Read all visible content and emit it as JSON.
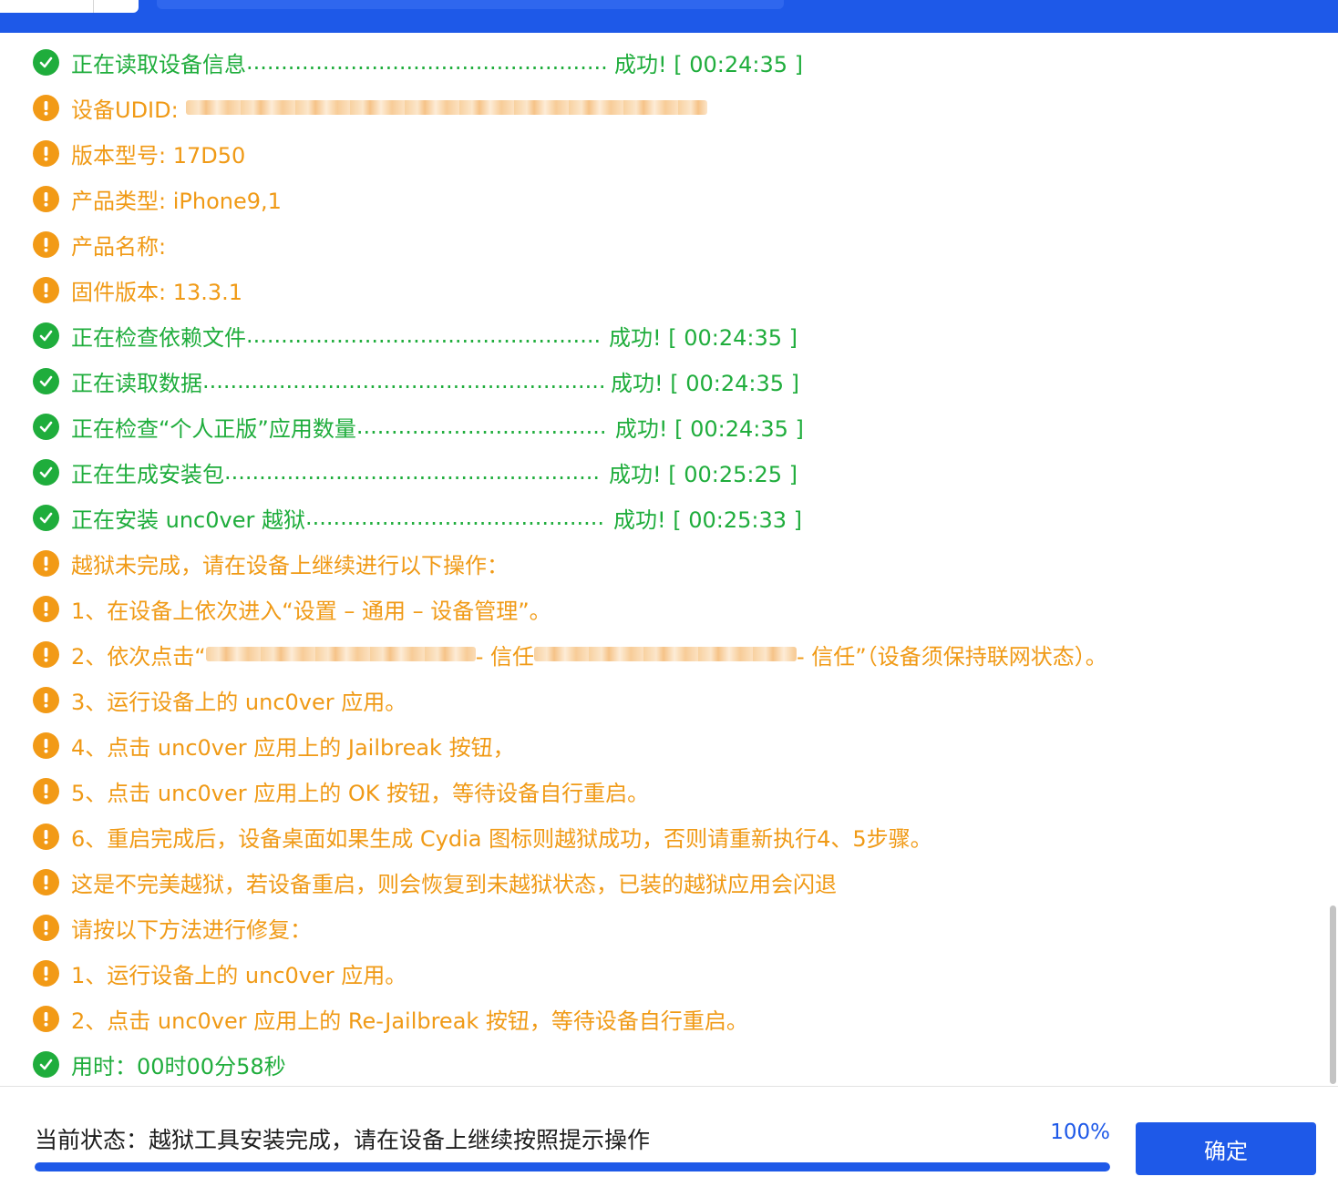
{
  "colors": {
    "accent": "#1e59e8",
    "success": "#1fad3c",
    "warning": "#f09a16"
  },
  "log": [
    {
      "type": "success",
      "icon": "check-circle-icon",
      "text": "正在读取设备信息",
      "dots": true,
      "result": "成功! [ 00:24:35 ]"
    },
    {
      "type": "warning",
      "icon": "warning-circle-icon",
      "text": "设备UDID:",
      "redacted": true
    },
    {
      "type": "warning",
      "icon": "warning-circle-icon",
      "text": "版本型号: 17D50"
    },
    {
      "type": "warning",
      "icon": "warning-circle-icon",
      "text": "产品类型: iPhone9,1"
    },
    {
      "type": "warning",
      "icon": "warning-circle-icon",
      "text": "产品名称:"
    },
    {
      "type": "warning",
      "icon": "warning-circle-icon",
      "text": "固件版本: 13.3.1"
    },
    {
      "type": "success",
      "icon": "check-circle-icon",
      "text": "正在检查依赖文件",
      "dots": true,
      "result": "成功! [ 00:24:35 ]"
    },
    {
      "type": "success",
      "icon": "check-circle-icon",
      "text": "正在读取数据",
      "dots": true,
      "result": "成功! [ 00:24:35 ]"
    },
    {
      "type": "success",
      "icon": "check-circle-icon",
      "text": "正在检查“个人正版”应用数量",
      "dots": true,
      "result": "成功! [ 00:24:35 ]"
    },
    {
      "type": "success",
      "icon": "check-circle-icon",
      "text": "正在生成安装包",
      "dots": true,
      "result": "成功! [ 00:25:25 ]"
    },
    {
      "type": "success",
      "icon": "check-circle-icon",
      "text": "正在安装 unc0ver 越狱",
      "dots": true,
      "result": "成功! [ 00:25:33 ]"
    },
    {
      "type": "warning",
      "icon": "warning-circle-icon",
      "text": "越狱未完成，请在设备上继续进行以下操作："
    },
    {
      "type": "warning",
      "icon": "warning-circle-icon",
      "text": "1、在设备上依次进入“设置 – 通用 – 设备管理”。"
    },
    {
      "type": "warning",
      "icon": "warning-circle-icon",
      "parts": [
        "2、依次点击“",
        " - 信任",
        " - 信任”（设备须保持联网状态）。"
      ]
    },
    {
      "type": "warning",
      "icon": "warning-circle-icon",
      "text": "3、运行设备上的 unc0ver 应用。"
    },
    {
      "type": "warning",
      "icon": "warning-circle-icon",
      "text": "4、点击 unc0ver 应用上的 Jailbreak 按钮，"
    },
    {
      "type": "warning",
      "icon": "warning-circle-icon",
      "text": "5、点击 unc0ver 应用上的 OK 按钮，等待设备自行重启。"
    },
    {
      "type": "warning",
      "icon": "warning-circle-icon",
      "text": "6、重启完成后，设备桌面如果生成 Cydia 图标则越狱成功，否则请重新执行4、5步骤。"
    },
    {
      "type": "warning",
      "icon": "warning-circle-icon",
      "text": "这是不完美越狱，若设备重启，则会恢复到未越狱状态，已装的越狱应用会闪退"
    },
    {
      "type": "warning",
      "icon": "warning-circle-icon",
      "text": "请按以下方法进行修复："
    },
    {
      "type": "warning",
      "icon": "warning-circle-icon",
      "text": "1、运行设备上的 unc0ver 应用。"
    },
    {
      "type": "warning",
      "icon": "warning-circle-icon",
      "text": "2、点击 unc0ver 应用上的 Re-Jailbreak 按钮，等待设备自行重启。"
    },
    {
      "type": "success",
      "icon": "check-circle-icon",
      "text": "用时：00时00分58秒"
    }
  ],
  "status": {
    "text": "当前状态：越狱工具安装完成，请在设备上继续按照提示操作",
    "percent_label": "100%",
    "progress": 1.0
  },
  "confirm_button": {
    "label": "确定"
  }
}
